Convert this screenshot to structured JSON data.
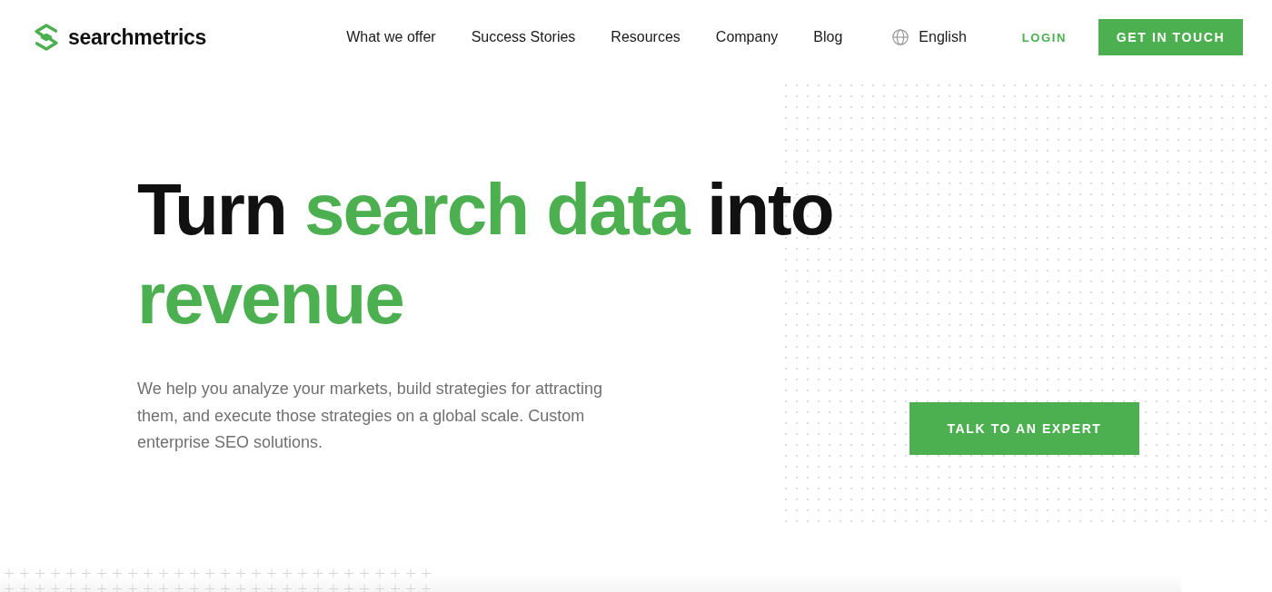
{
  "header": {
    "logo": "searchmetrics",
    "nav": [
      "What we offer",
      "Success Stories",
      "Resources",
      "Company",
      "Blog"
    ],
    "language": "English",
    "login": "LOGIN",
    "cta": "GET IN TOUCH"
  },
  "hero": {
    "headline": [
      {
        "text": "Turn",
        "accent": false
      },
      {
        "text": "search data",
        "accent": true
      },
      {
        "text": "into",
        "accent": false
      },
      {
        "text": "revenue",
        "accent": true
      }
    ],
    "description": "We help you analyze your markets, build strategies for attracting them, and execute those strategies on a global scale. Custom enterprise SEO solutions.",
    "cta": "TALK TO AN EXPERT"
  }
}
